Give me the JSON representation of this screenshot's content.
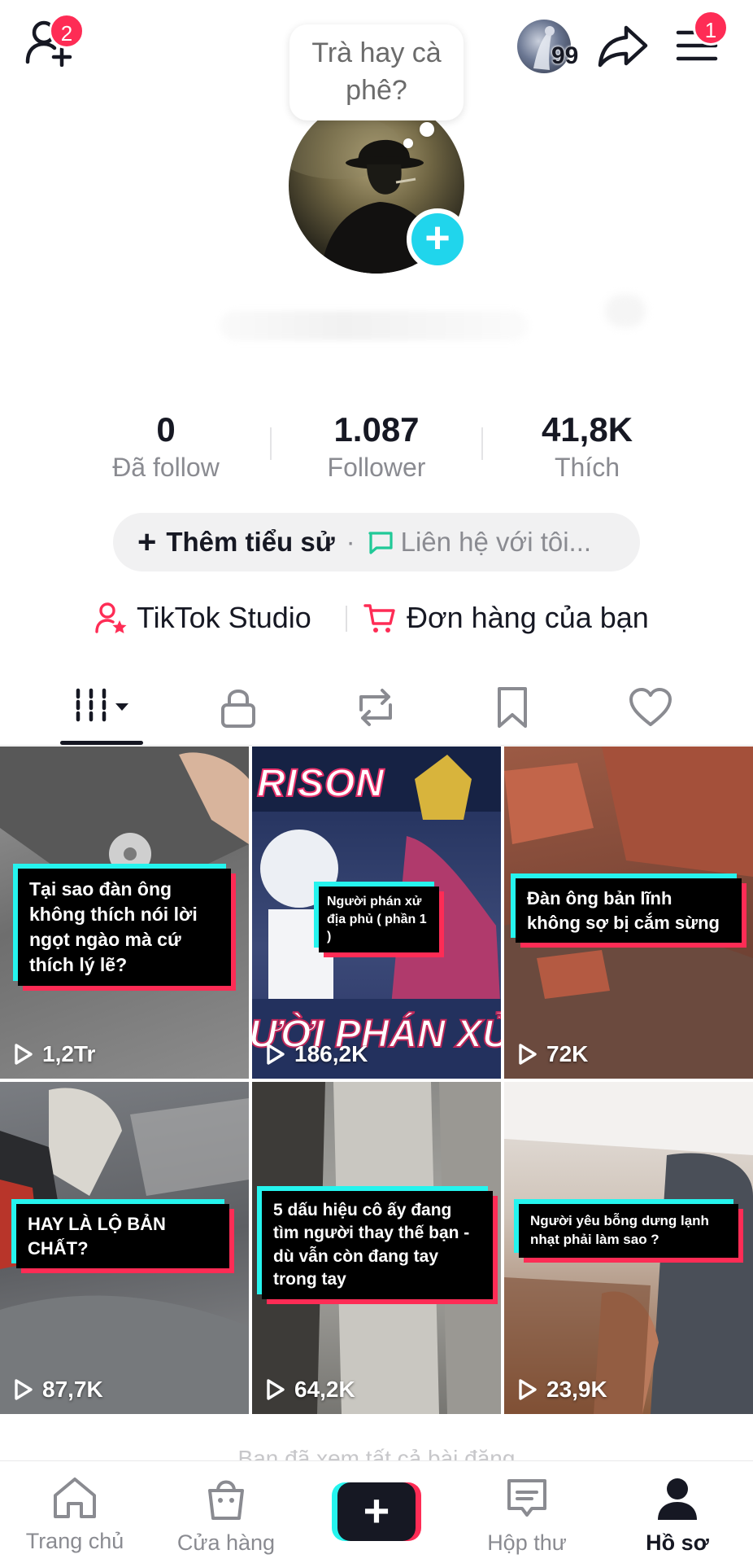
{
  "header": {
    "add_friend_badge": "2",
    "story_count": "99",
    "menu_badge": "1"
  },
  "profile": {
    "bubble_text": "Trà hay cà phê?"
  },
  "stats": [
    {
      "value": "0",
      "label": "Đã follow"
    },
    {
      "value": "1.087",
      "label": "Follower"
    },
    {
      "value": "41,8K",
      "label": "Thích"
    }
  ],
  "bio": {
    "add_label": "Thêm tiểu sử",
    "separator": "·",
    "contact_label": "Liên hệ với tôi..."
  },
  "links": {
    "studio_label": "TikTok Studio",
    "orders_label": "Đơn hàng của bạn"
  },
  "tabs": [
    {
      "name": "videos-grid-icon"
    },
    {
      "name": "lock-icon"
    },
    {
      "name": "repost-icon"
    },
    {
      "name": "bookmark-icon"
    },
    {
      "name": "heart-icon"
    }
  ],
  "videos": [
    {
      "caption": "Tại sao đàn ông không thích nói lời ngọt ngào mà cứ thích lý lẽ?",
      "views": "1,2Tr"
    },
    {
      "caption": "Người phán xử địa phủ ( phần 1 )",
      "views": "186,2K",
      "overlay_top": "RISON",
      "overlay_bottom": "ƯỜI PHÁN XỬ ĐỊ"
    },
    {
      "caption": "Đàn ông bản lĩnh không sợ bị cắm sừng",
      "views": "72K"
    },
    {
      "caption": "HAY LÀ LỘ BẢN CHẤT?",
      "views": "87,7K"
    },
    {
      "caption": "5 dấu hiệu cô ấy đang tìm người thay thế bạn - dù vẫn còn đang tay trong tay",
      "views": "64,2K"
    },
    {
      "caption": "Người yêu bỗng dưng lạnh nhạt phải làm sao ?",
      "views": "23,9K"
    }
  ],
  "footer_hint": "Bạn đã xem tất cả bài đăng",
  "nav": [
    {
      "label": "Trang chủ",
      "icon": "home-icon"
    },
    {
      "label": "Cửa hàng",
      "icon": "shop-bag-icon"
    },
    {
      "label": "",
      "icon": "plus-icon"
    },
    {
      "label": "Hộp thư",
      "icon": "inbox-icon"
    },
    {
      "label": "Hồ sơ",
      "icon": "profile-icon"
    }
  ],
  "colors": {
    "accent_red": "#fe2c55",
    "accent_cyan": "#25f4ee",
    "text_primary": "#161823",
    "text_secondary": "#8a8b91"
  }
}
